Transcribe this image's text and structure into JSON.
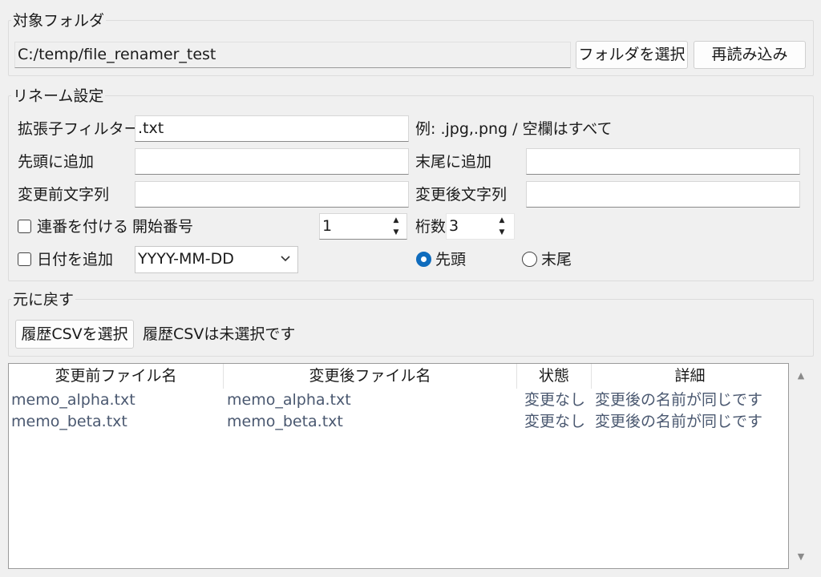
{
  "target_folder": {
    "legend": "対象フォルダ",
    "path": "C:/temp/file_renamer_test",
    "select_button": "フォルダを選択",
    "reload_button": "再読み込み"
  },
  "rename_settings": {
    "legend": "リネーム設定",
    "ext_filter_label": "拡張子フィルター",
    "ext_filter_value": ".txt",
    "ext_hint": "例: .jpg,.png / 空欄はすべて",
    "prefix_label": "先頭に追加",
    "prefix_value": "",
    "suffix_label": "末尾に追加",
    "suffix_value": "",
    "before_label": "変更前文字列",
    "before_value": "",
    "after_label": "変更後文字列",
    "after_value": "",
    "serial_checkbox_label": "連番を付ける",
    "serial_checked": false,
    "start_number_label": "開始番号",
    "start_number_value": "1",
    "digits_label": "桁数",
    "digits_value": "3",
    "date_checkbox_label": "日付を追加",
    "date_checked": false,
    "date_format": "YYYY-MM-DD",
    "position_head_label": "先頭",
    "position_tail_label": "末尾",
    "position_selected": "先頭"
  },
  "undo": {
    "legend": "元に戻す",
    "select_csv_button": "履歴CSVを選択",
    "csv_status": "履歴CSVは未選択です"
  },
  "table": {
    "columns": [
      "変更前ファイル名",
      "変更後ファイル名",
      "状態",
      "詳細"
    ],
    "rows": [
      [
        "memo_alpha.txt",
        "memo_alpha.txt",
        "変更なし",
        "変更後の名前が同じです"
      ],
      [
        "memo_beta.txt",
        "memo_beta.txt",
        "変更なし",
        "変更後の名前が同じです"
      ]
    ]
  },
  "colors": {
    "accent": "#0f6cbd",
    "row_text": "#4a5870"
  },
  "icons": {
    "spin_up": "triangle-up-icon",
    "spin_down": "triangle-down-icon",
    "dropdown": "chevron-down-icon",
    "scroll_up": "scroll-up-arrow-icon",
    "scroll_down": "scroll-down-arrow-icon"
  }
}
